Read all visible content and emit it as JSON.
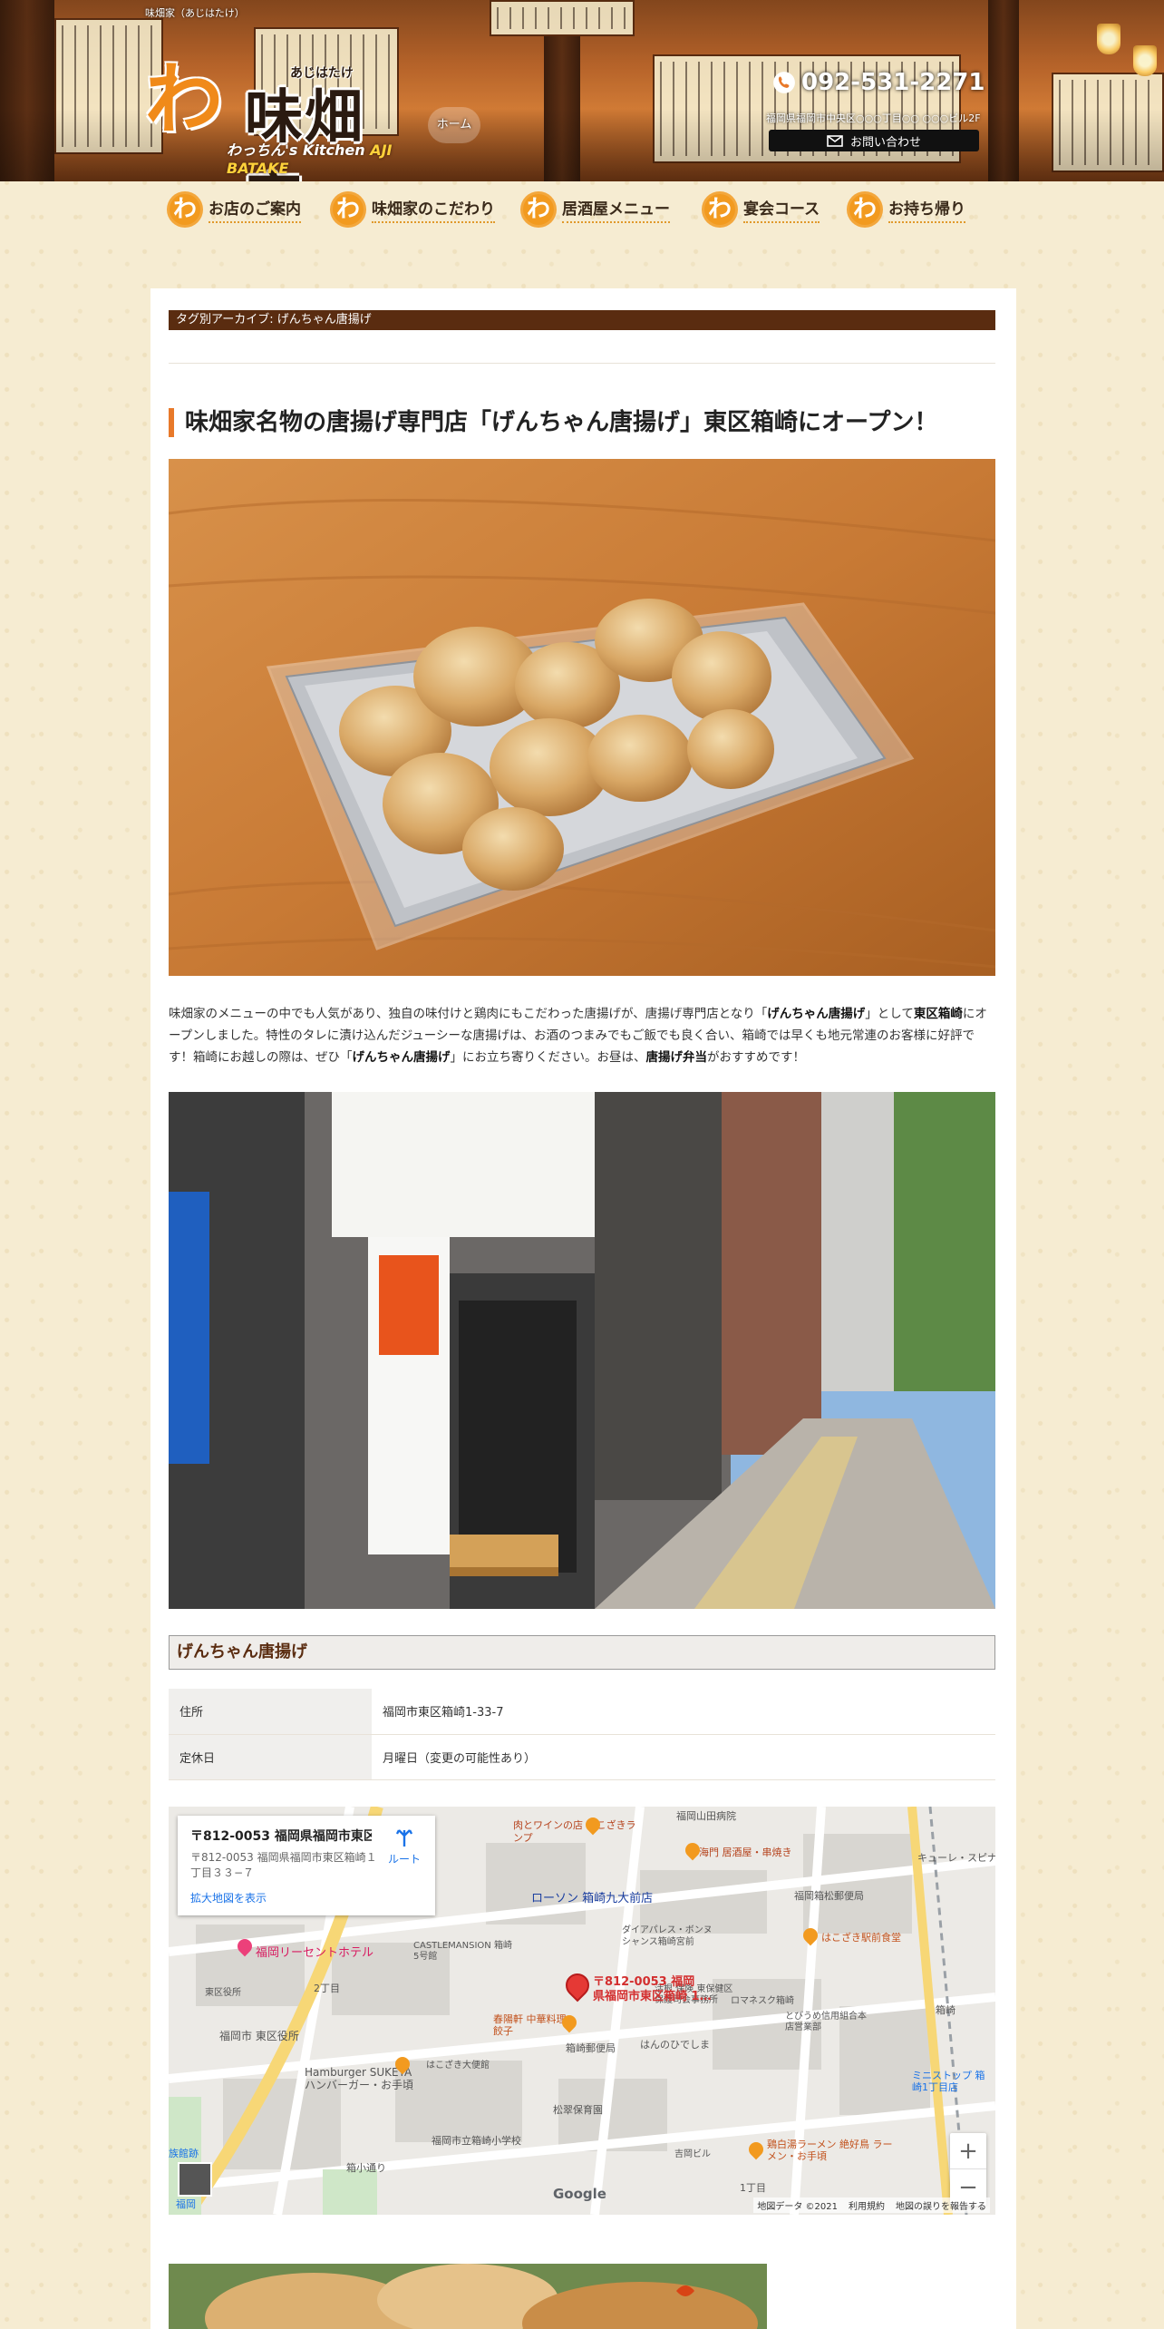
{
  "header": {
    "tagline": "味畑家（あじはたけ）",
    "logo_mark": "わ",
    "logo_text": "味畑家",
    "logo_ruby": "あじはたけ",
    "logo_sub_prefix": "わっちん's Kitchen ",
    "logo_sub_brand": "AJI BATAKE",
    "home_label": "ホーム",
    "phone": "092-531-2271",
    "address": "福岡県福岡市中央区○○○丁目○○ ○○○ビル2F",
    "contact_label": "お問い合わせ"
  },
  "nav": {
    "items": [
      {
        "badge": "わ",
        "label": "お店のご案内"
      },
      {
        "badge": "わ",
        "label": "味畑家のこだわり"
      },
      {
        "badge": "わ",
        "label": "居酒屋メニュー"
      },
      {
        "badge": "わ",
        "label": "宴会コース"
      },
      {
        "badge": "わ",
        "label": "お持ち帰り"
      }
    ]
  },
  "archive": {
    "label": "タグ別アーカイブ: げんちゃん唐揚げ"
  },
  "post": {
    "title": "味畑家名物の唐揚げ専門店「げんちゃん唐揚げ」東区箱崎にオープン！",
    "p_1": "味畑家のメニューの中でも人気があり、独自の味付けと鶏肉にもこだわった唐揚げが、唐揚げ専門店となり「",
    "b_1": "げんちゃん唐揚げ",
    "p_2": "」として",
    "b_2": "東区箱崎",
    "p_3": "にオープンしました。特性のタレに漬け込んだジューシーな唐揚げは、お酒のつまみでもご飯でも良く合い、箱崎では早くも地元常連のお客様に好評です！箱崎にお越しの際は、ぜひ「",
    "b_3": "げんちゃん唐揚げ",
    "p_4": "」にお立ち寄りください。お昼は、",
    "b_4": "唐揚げ弁当",
    "p_5": "がおすすめです！"
  },
  "shop": {
    "heading": "げんちゃん唐揚げ",
    "rows": [
      {
        "key": "住所",
        "value": "福岡市東区箱崎1-33-7"
      },
      {
        "key": "定休日",
        "value": "月曜日（変更の可能性あり）"
      }
    ]
  },
  "map": {
    "card_title": "〒812-0053 福岡県福岡市東区...",
    "card_address": "〒812-0053 福岡県福岡市東区箱崎１丁目３３−７",
    "card_link": "拡大地図を表示",
    "route_label": "ルート",
    "pin_label_1": "〒812-0053 福岡",
    "pin_label_2": "県福岡市東区箱崎 1…",
    "zoom_in": "+",
    "zoom_out": "−",
    "attribution": [
      "地図データ ©2021",
      "利用規約",
      "地図の誤りを報告する"
    ],
    "google": "Google",
    "labels": [
      "福岡山田病院",
      "肉とワインの店 はこざきランプ",
      "海門 居酒屋・串焼き",
      "キューレ・スピナ",
      "ローソン 箱崎九大前店",
      "福岡箱松郵便局",
      "ダイアパレス・ボンヌ シャンス箱崎宮前",
      "はこざき駅前食堂",
      "福岡リーセントホテル",
      "CASTLEMANSION 箱崎5号館",
      "ロマネスク箱崎",
      "東区役所",
      "2丁目",
      "春陽軒 中華料理・餃子",
      "福岡市 東区役所",
      "箱崎郵便局",
      "はんのひでしま",
      "とびうめ信用組合本店営業部",
      "ミニストップ 箱崎1丁目店",
      "Hamburger SUKEYA ハンバーガー・お手頃",
      "はこざき大便館",
      "松翠保育園",
      "福岡市立箱崎小学校",
      "鶏白湯ラーメン 絶好鳥 ラーメン・お手頃",
      "箱崎",
      "箱小通り",
      "福岡",
      "1丁目",
      "吉岡ビル",
      "族館跡",
      "活根 保険 東保健区保護司会事務所"
    ]
  }
}
